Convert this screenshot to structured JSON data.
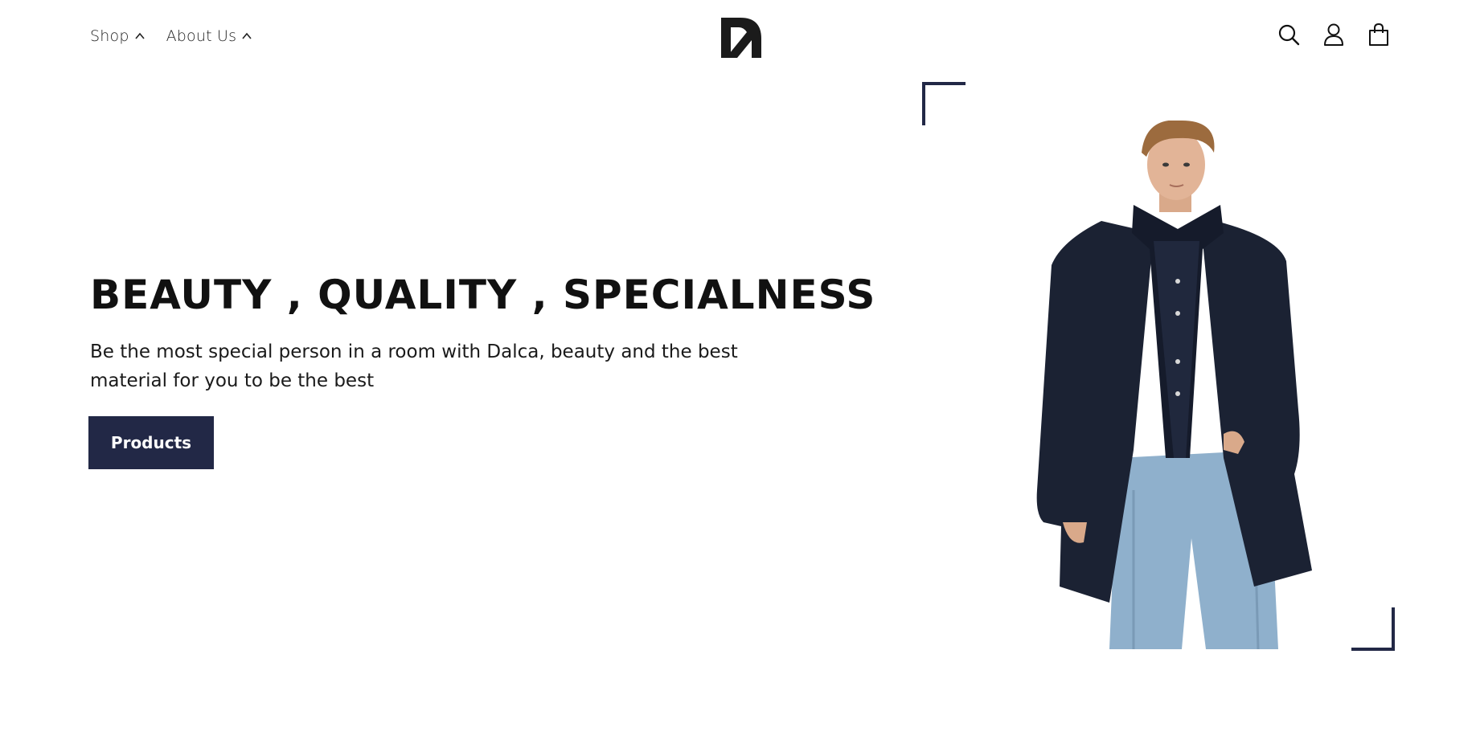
{
  "header": {
    "nav": [
      {
        "label": "Shop"
      },
      {
        "label": "About Us"
      }
    ],
    "icons": [
      "search-icon",
      "user-icon",
      "shopping-bag-icon"
    ]
  },
  "hero": {
    "title": "BEAUTY , QUALITY , SPECIALNESS",
    "subtitle": "Be the most special person in a room with Dalca, beauty and the best material for you to be the best",
    "button_label": "Products"
  },
  "colors": {
    "accent": "#222846",
    "text": "#111111",
    "background": "#ffffff"
  }
}
